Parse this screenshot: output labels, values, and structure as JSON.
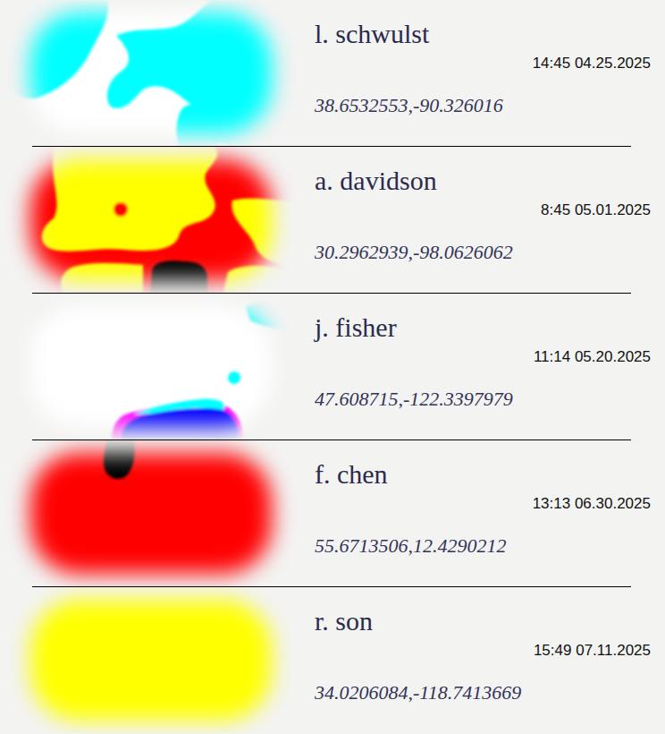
{
  "entries": [
    {
      "name": "l. schwulst",
      "time": "14:45 04.25.2025",
      "coords": "38.6532553,-90.326016"
    },
    {
      "name": "a. davidson",
      "time": "8:45 05.01.2025",
      "coords": "30.2962939,-98.0626062"
    },
    {
      "name": "j. fisher",
      "time": "11:14 05.20.2025",
      "coords": "47.608715,-122.3397979"
    },
    {
      "name": "f. chen",
      "time": "13:13 06.30.2025",
      "coords": "55.6713506,12.4290212"
    },
    {
      "name": "r. son",
      "time": "15:49 07.11.2025",
      "coords": "34.0206084,-118.7413669"
    }
  ]
}
